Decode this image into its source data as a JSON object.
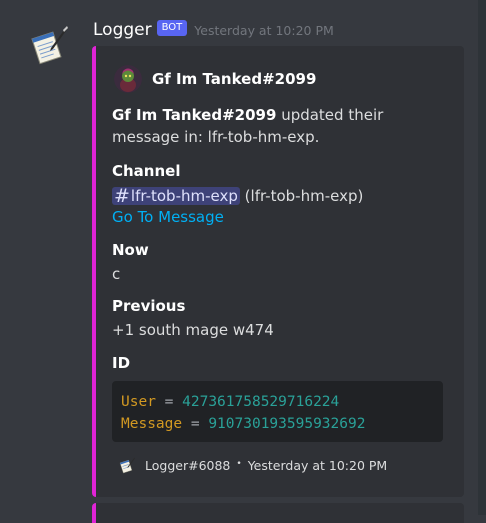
{
  "message": {
    "author": "Logger",
    "bot_tag": "BOT",
    "timestamp": "Yesterday at 10:20 PM"
  },
  "embed": {
    "accent_color": "#e024d6",
    "author_name": "Gf Im Tanked#2099",
    "description": {
      "user": "Gf Im Tanked#2099",
      "text": "updated their message in: lfr-tob-hm-exp."
    },
    "fields": {
      "channel": {
        "name": "Channel",
        "mention": "lfr-tob-hm-exp",
        "plain": "(lfr-tob-hm-exp)",
        "link": "Go To Message"
      },
      "now": {
        "name": "Now",
        "value": "c"
      },
      "previous": {
        "name": "Previous",
        "value": "+1 south mage w474"
      },
      "id": {
        "name": "ID",
        "user_key": "User",
        "user_value": "427361758529716224",
        "message_key": "Message",
        "message_value": "910730193595932692"
      }
    },
    "footer": {
      "text": "Logger#6088",
      "separator": "•",
      "timestamp": "Yesterday at 10:20 PM"
    }
  },
  "colors": {
    "background": "#36393f",
    "embed_bg": "#2f3136",
    "link": "#00b0f4",
    "bot_tag": "#5865f2",
    "mention_bg": "#3e4278"
  },
  "icons": {
    "avatar": "notepad-quill-icon",
    "author_avatar": "user-avatar",
    "footer": "notepad-quill-icon"
  }
}
